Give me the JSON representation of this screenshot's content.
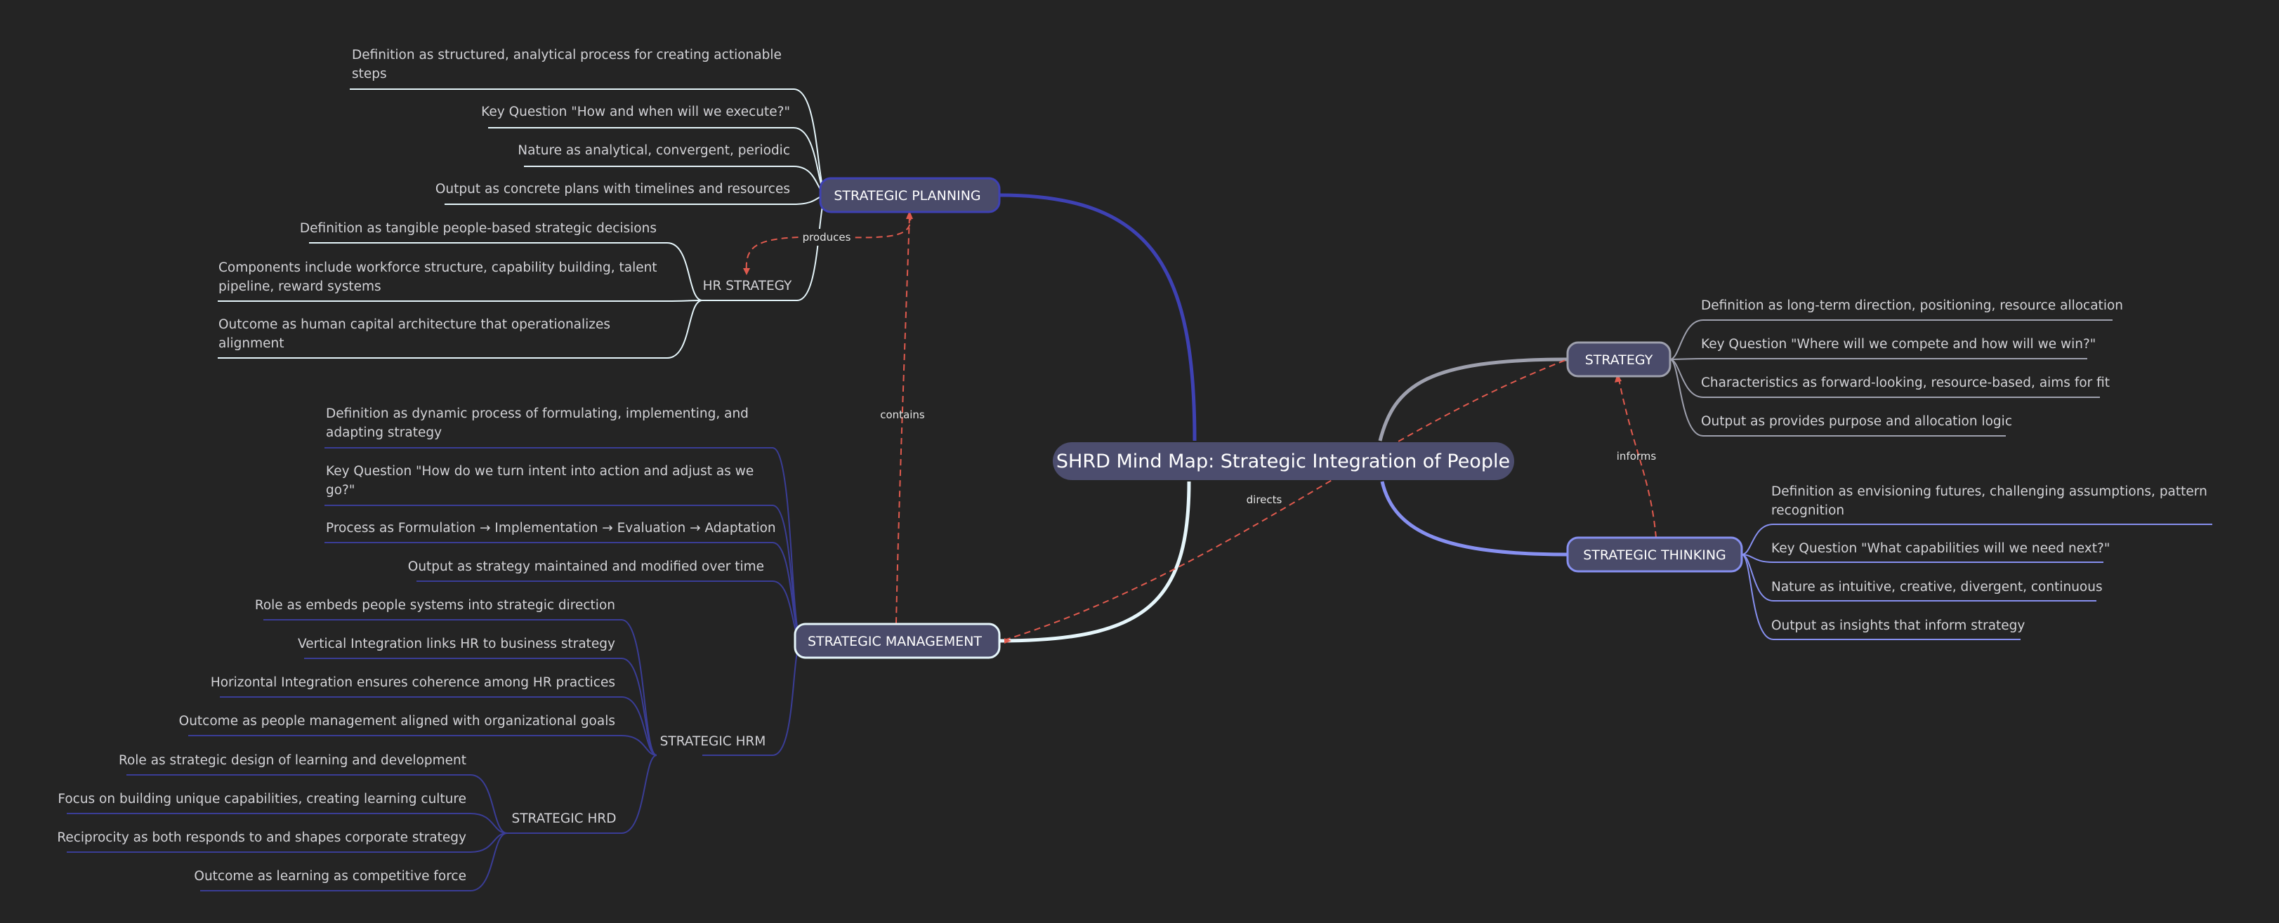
{
  "colors": {
    "background": "#242424",
    "root_fill": "#4c4d6e",
    "node_fill": "#4a4b6a",
    "node_fill_alt": "#3f4058",
    "leaf_text": "#d2d2d6",
    "node_text": "#ffffff",
    "branch_strategy": "#9ea0ad",
    "branch_thinking": "#8790f0",
    "branch_planning": "#3e41b3",
    "branch_management": "#e6f6fb",
    "branch_hrm": "#3a3d96",
    "relation_line": "#e05a4e"
  },
  "root": {
    "label": "SHRD Mind Map: Strategic Integration of People"
  },
  "nodes": {
    "strategy": {
      "label": "STRATEGY",
      "leaves": [
        "Definition as long-term direction, positioning, resource allocation",
        "Key Question \"Where will we compete and how will we win?\"",
        "Characteristics as forward-looking, resource-based, aims for fit",
        "Output as provides purpose and allocation logic"
      ]
    },
    "thinking": {
      "label": "STRATEGIC THINKING",
      "leaves": [
        [
          "Definition as envisioning futures, challenging assumptions, pattern",
          "recognition"
        ],
        "Key Question \"What capabilities will we need next?\"",
        "Nature as intuitive, creative, divergent, continuous",
        "Output as insights that inform strategy"
      ]
    },
    "planning": {
      "label": "STRATEGIC PLANNING",
      "leaves": [
        [
          "Definition as structured, analytical process for creating actionable",
          "steps"
        ],
        "Key Question \"How and when will we execute?\"",
        "Nature as analytical, convergent, periodic",
        "Output as concrete plans with timelines and resources"
      ]
    },
    "hr_strategy": {
      "label": "HR STRATEGY",
      "leaves": [
        "Definition as tangible people-based strategic decisions",
        [
          "Components include workforce structure, capability building, talent",
          "pipeline, reward systems"
        ],
        [
          "Outcome as human capital architecture that operationalizes",
          "alignment"
        ]
      ]
    },
    "management": {
      "label": "STRATEGIC MANAGEMENT",
      "leaves": [
        [
          "Definition as dynamic process of formulating, implementing, and",
          "adapting strategy"
        ],
        [
          "Key Question \"How do we turn intent into action and adjust as we",
          "go?\""
        ],
        "Process as Formulation → Implementation → Evaluation → Adaptation",
        "Output as strategy maintained and modified over time"
      ]
    },
    "hrm": {
      "label": "STRATEGIC HRM",
      "leaves": [
        "Role as embeds people systems into strategic direction",
        "Vertical Integration links HR to business strategy",
        "Horizontal Integration ensures coherence among HR practices",
        "Outcome as people management aligned with organizational goals"
      ]
    },
    "hrd": {
      "label": "STRATEGIC HRD",
      "leaves": [
        "Role as strategic design of learning and development",
        "Focus on building unique capabilities, creating learning culture",
        "Reciprocity as both responds to and shapes corporate strategy",
        "Outcome as learning as competitive force"
      ]
    }
  },
  "relations": {
    "produces": "produces",
    "contains": "contains",
    "directs": "directs",
    "informs": "informs"
  }
}
